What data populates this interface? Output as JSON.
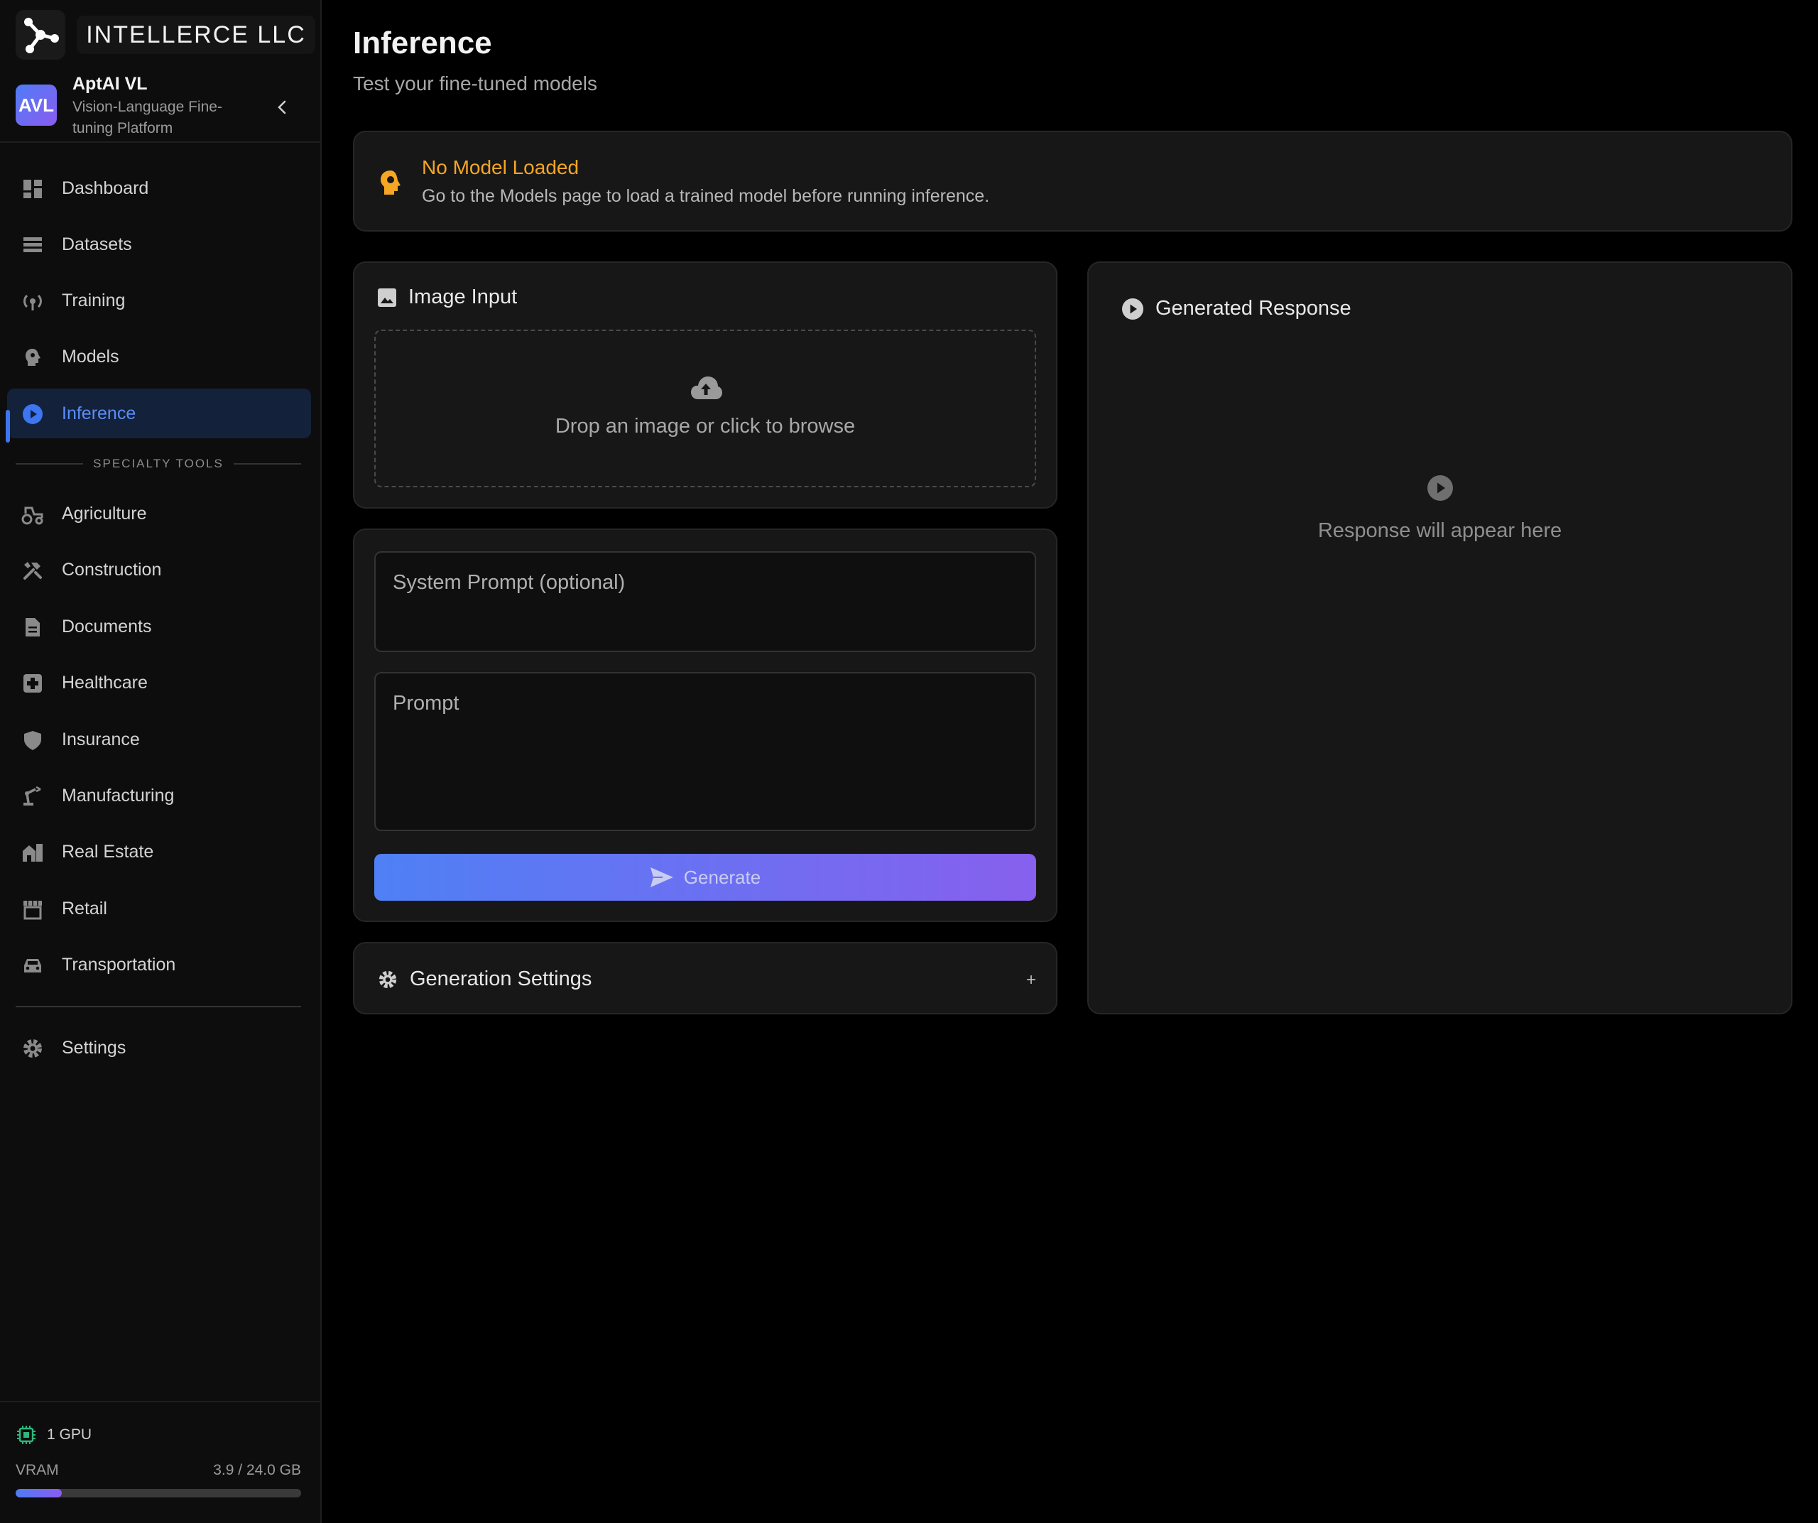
{
  "brand": {
    "name": "INTELLERCE LLC"
  },
  "app": {
    "avatar": "AVL",
    "title": "AptAI VL",
    "subtitle": "Vision-Language Fine-tuning Platform"
  },
  "nav": {
    "primary": [
      "Dashboard",
      "Datasets",
      "Training",
      "Models",
      "Inference"
    ],
    "active": "Inference",
    "section_label": "SPECIALTY TOOLS",
    "specialty": [
      "Agriculture",
      "Construction",
      "Documents",
      "Healthcare",
      "Insurance",
      "Manufacturing",
      "Real Estate",
      "Retail",
      "Transportation"
    ],
    "settings": "Settings"
  },
  "gpu": {
    "label": "1 GPU",
    "vram_label": "VRAM",
    "vram_value": "3.9 / 24.0 GB",
    "vram_used_fraction": 0.1625
  },
  "page": {
    "title": "Inference",
    "subtitle": "Test your fine-tuned models"
  },
  "alert": {
    "title": "No Model Loaded",
    "message": "Go to the Models page to load a trained model before running inference."
  },
  "image_input": {
    "title": "Image Input",
    "drop_text": "Drop an image or click to browse"
  },
  "prompt_form": {
    "system_placeholder": "System Prompt (optional)",
    "prompt_placeholder": "Prompt",
    "generate_label": "Generate"
  },
  "settings_panel": {
    "title": "Generation Settings",
    "toggle": "+"
  },
  "response": {
    "title": "Generated Response",
    "empty_text": "Response will appear here"
  },
  "colors": {
    "accent": "#3d76f2",
    "warning": "#f5a623",
    "gradient_start": "#4f80f5",
    "gradient_end": "#8760ee",
    "gpu_icon": "#2fb67c"
  }
}
